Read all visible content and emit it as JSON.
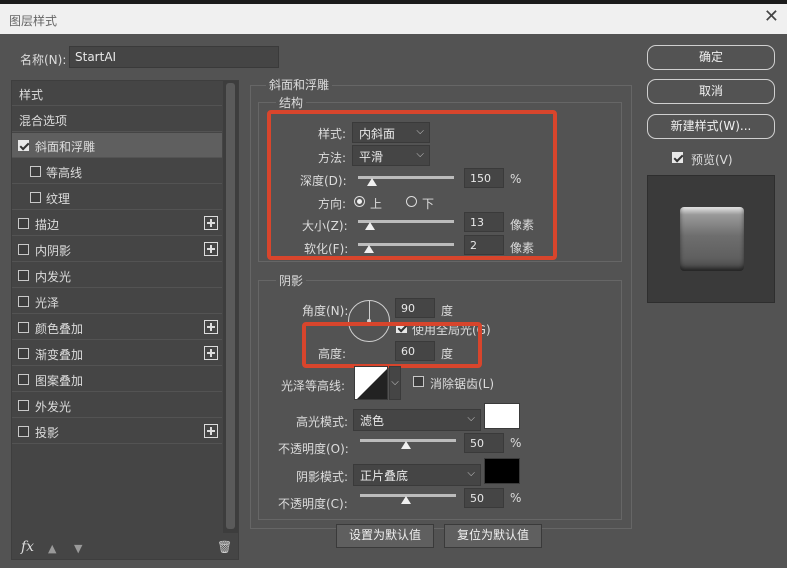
{
  "window": {
    "title": "图层样式",
    "close_glyph": "✕"
  },
  "name_field": {
    "label": "名称(N):",
    "value": "StartAI"
  },
  "left_panel": {
    "items": [
      {
        "label": "样式"
      },
      {
        "label": "混合选项"
      },
      {
        "label": "斜面和浮雕"
      },
      {
        "label": "等高线"
      },
      {
        "label": "纹理"
      },
      {
        "label": "描边"
      },
      {
        "label": "内阴影"
      },
      {
        "label": "内发光"
      },
      {
        "label": "光泽"
      },
      {
        "label": "颜色叠加"
      },
      {
        "label": "渐变叠加"
      },
      {
        "label": "图案叠加"
      },
      {
        "label": "外发光"
      },
      {
        "label": "投影"
      }
    ],
    "fx_label": "fx",
    "up_glyph": "▲",
    "down_glyph": "▼",
    "trash_glyph": "🗑"
  },
  "bevel": {
    "group_title": "斜面和浮雕",
    "structure": {
      "title": "结构",
      "style_label": "样式:",
      "style_value": "内斜面",
      "technique_label": "方法:",
      "technique_value": "平滑",
      "depth_label": "深度(D):",
      "depth_value": "150",
      "depth_unit": "%",
      "direction_label": "方向:",
      "direction_up": "上",
      "direction_down": "下",
      "size_label": "大小(Z):",
      "size_value": "13",
      "size_unit": "像素",
      "soften_label": "软化(F):",
      "soften_value": "2",
      "soften_unit": "像素"
    },
    "shading": {
      "title": "阴影",
      "angle_label": "角度(N):",
      "angle_value": "90",
      "angle_unit": "度",
      "global_light_label": "使用全局光(G)",
      "altitude_label": "高度:",
      "altitude_value": "60",
      "altitude_unit": "度",
      "gloss_contour_label": "光泽等高线:",
      "anti_alias_label": "消除锯齿(L)",
      "highlight_mode_label": "高光模式:",
      "highlight_mode_value": "滤色",
      "highlight_color": "#ffffff",
      "highlight_opacity_label": "不透明度(O):",
      "highlight_opacity_value": "50",
      "highlight_opacity_unit": "%",
      "shadow_mode_label": "阴影模式:",
      "shadow_mode_value": "正片叠底",
      "shadow_color": "#000000",
      "shadow_opacity_label": "不透明度(C):",
      "shadow_opacity_value": "50",
      "shadow_opacity_unit": "%"
    },
    "make_default": "设置为默认值",
    "reset_default": "复位为默认值"
  },
  "actions": {
    "ok": "确定",
    "cancel": "取消",
    "new_style": "新建样式(W)...",
    "preview_label": "预览(V)"
  },
  "colors": {
    "highlight_box": "#d8452c",
    "dialog_bg": "#535353"
  }
}
